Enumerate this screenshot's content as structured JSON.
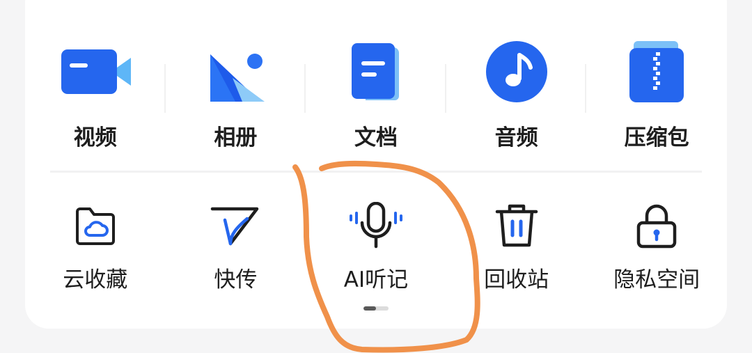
{
  "top_row": [
    {
      "label": "视频",
      "icon": "video-icon"
    },
    {
      "label": "相册",
      "icon": "photo-album-icon"
    },
    {
      "label": "文档",
      "icon": "document-icon"
    },
    {
      "label": "音频",
      "icon": "music-note-icon"
    },
    {
      "label": "压缩包",
      "icon": "zip-archive-icon"
    }
  ],
  "bottom_row": [
    {
      "label": "云收藏",
      "icon": "cloud-folder-icon"
    },
    {
      "label": "快传",
      "icon": "paper-plane-icon"
    },
    {
      "label": "AI听记",
      "icon": "microphone-icon"
    },
    {
      "label": "回收站",
      "icon": "trash-icon"
    },
    {
      "label": "隐私空间",
      "icon": "lock-icon"
    }
  ],
  "pager": {
    "pages": 2,
    "current": 1
  },
  "colors": {
    "accent": "#2a6bf2",
    "annotation": "#f0914a",
    "text": "#1e1e1e"
  }
}
